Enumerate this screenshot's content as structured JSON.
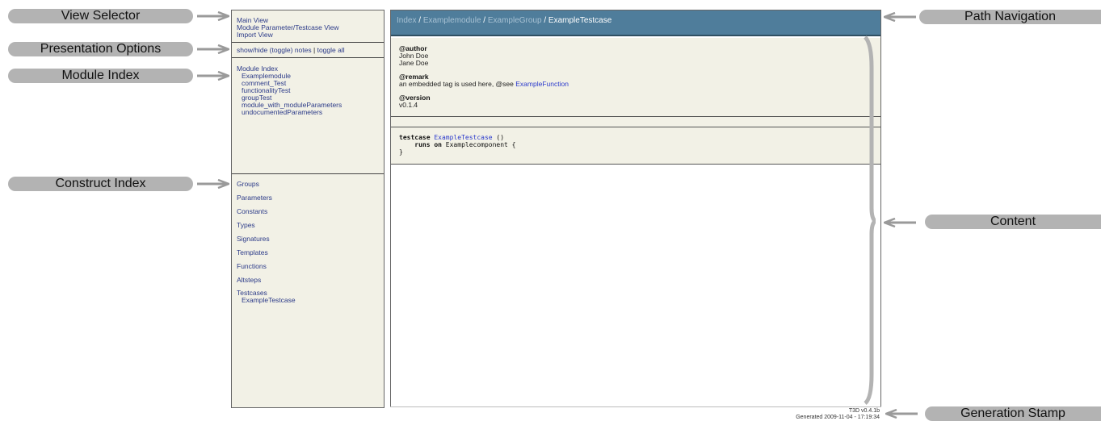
{
  "callouts": {
    "view_selector": "View Selector",
    "presentation_options": "Presentation Options",
    "module_index": "Module Index",
    "construct_index": "Construct Index",
    "path_navigation": "Path Navigation",
    "content": "Content",
    "generation_stamp": "Generation Stamp"
  },
  "views": {
    "main": "Main View",
    "module_param": "Module Parameter/Testcase View",
    "import": "Import View"
  },
  "presentation": {
    "toggle_notes": "show/hide (toggle) notes",
    "separator": "|",
    "toggle_all": "toggle all"
  },
  "module_index": {
    "title": "Module Index",
    "items": [
      "Examplemodule",
      "comment_Test",
      "functionalityTest",
      "groupTest",
      "module_with_moduleParameters",
      "undocumentedParameters"
    ]
  },
  "construct_index": {
    "items": [
      "Groups",
      "Parameters",
      "Constants",
      "Types",
      "Signatures",
      "Templates",
      "Functions",
      "Altsteps"
    ],
    "testcases_label": "Testcases",
    "testcases": [
      "ExampleTestcase"
    ]
  },
  "path": {
    "index": "Index",
    "module": "Examplemodule",
    "group": "ExampleGroup",
    "current": "ExampleTestcase",
    "sep": " / "
  },
  "doc": {
    "author_tag": "@author",
    "authors": [
      "John Doe",
      "Jane Doe"
    ],
    "remark_tag": "@remark",
    "remark_text": "an embedded tag is used here, @see",
    "remark_link": "ExampleFunction",
    "version_tag": "@version",
    "version": "v0.1.4"
  },
  "code": {
    "kw1": "testcase",
    "name": "ExampleTestcase",
    "params": " ()",
    "kw2": "runs on",
    "component": " Examplecomponent {",
    "close": "}"
  },
  "stamp": {
    "version": "T3D v0.4.1b",
    "generated": "Generated 2009-11-04 - 17:19:34"
  },
  "colors": {
    "panel_bg": "#f2f1e6",
    "path_bar": "#4f7d9b",
    "link": "#2b3a88",
    "callout": "#b3b3b3"
  }
}
